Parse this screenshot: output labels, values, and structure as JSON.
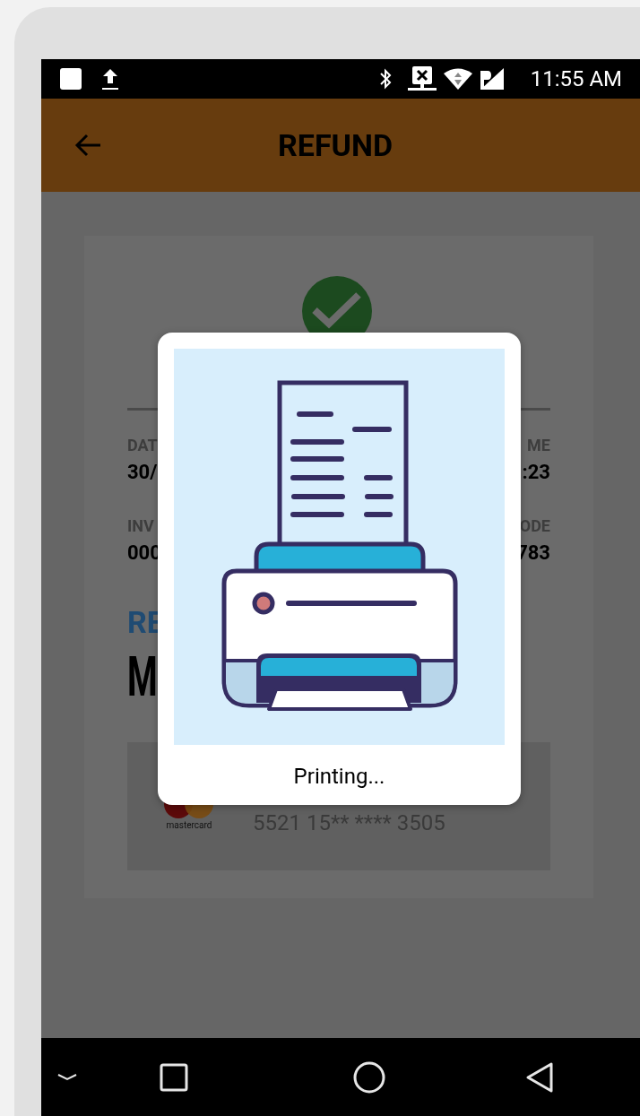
{
  "status_bar": {
    "time": "11:55 AM"
  },
  "app_bar": {
    "title": "REFUND"
  },
  "receipt": {
    "rows": [
      {
        "left": {
          "label": "DAT",
          "value": "30/"
        },
        "right": {
          "label": "ME",
          "value": ":23"
        }
      },
      {
        "left": {
          "label": "INV",
          "value": "000"
        },
        "right": {
          "label": "ODE",
          "value": "783"
        }
      }
    ],
    "heading": "RE",
    "amount": "M",
    "payment": {
      "brand": "mastercard",
      "card_number": "5521 15** **** 3505"
    }
  },
  "dialog": {
    "message": "Printing..."
  }
}
